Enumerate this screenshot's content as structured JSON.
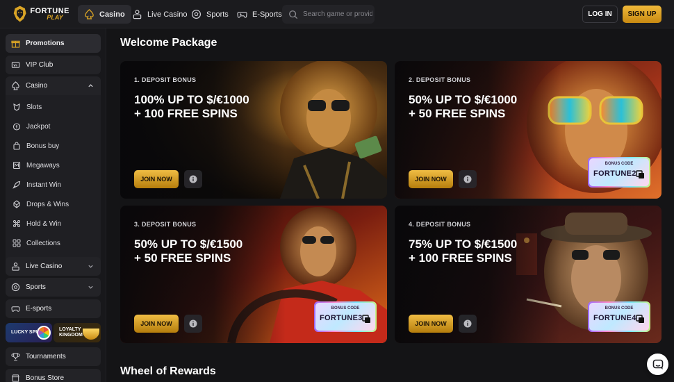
{
  "header": {
    "logo_line1": "FORTUNE",
    "logo_line2": "PLAY",
    "nav": [
      {
        "label": "Casino",
        "icon": "spade-icon",
        "active": true
      },
      {
        "label": "Live Casino",
        "icon": "dealer-icon",
        "active": false
      },
      {
        "label": "Sports",
        "icon": "soccer-ball-icon",
        "active": false
      },
      {
        "label": "E-Sports",
        "icon": "gamepad-icon",
        "active": false
      }
    ],
    "search_placeholder": "Search game or provider",
    "login_label": "LOG IN",
    "signup_label": "SIGN UP"
  },
  "sidebar": {
    "items": [
      {
        "label": "Promotions",
        "icon": "gift-icon"
      },
      {
        "label": "VIP Club",
        "icon": "vip-icon"
      },
      {
        "label": "Casino",
        "icon": "spade-icon",
        "expanded": true
      }
    ],
    "casino_sub": [
      {
        "label": "Slots",
        "icon": "slot-icon"
      },
      {
        "label": "Jackpot",
        "icon": "jackpot-icon"
      },
      {
        "label": "Bonus buy",
        "icon": "bag-icon"
      },
      {
        "label": "Megaways",
        "icon": "megaways-icon"
      },
      {
        "label": "Instant Win",
        "icon": "rocket-icon"
      },
      {
        "label": "Drops & Wins",
        "icon": "drops-icon"
      },
      {
        "label": "Hold & Win",
        "icon": "hold-icon"
      },
      {
        "label": "Collections",
        "icon": "collections-icon"
      }
    ],
    "items_after": [
      {
        "label": "Live Casino",
        "icon": "dealer-icon"
      },
      {
        "label": "Sports",
        "icon": "soccer-ball-icon"
      },
      {
        "label": "E-sports",
        "icon": "gamepad-icon"
      }
    ],
    "lucky_spin": "LUCKY SPIN",
    "loyalty_line1": "LOYALTY",
    "loyalty_line2": "KINGDOM",
    "tournaments": "Tournaments",
    "bonus_store": "Bonus Store"
  },
  "main": {
    "welcome_title": "Welcome Package",
    "wheel_title": "Wheel of Rewards",
    "cards": [
      {
        "label": "1. DEPOSIT BONUS",
        "line1": "100% UP TO $/€1000",
        "line2": "+ 100 FREE SPINS",
        "join": "JOIN NOW",
        "code_title": "",
        "code": ""
      },
      {
        "label": "2. DEPOSIT BONUS",
        "line1": "50% UP TO $/€1000",
        "line2": "+ 50 FREE SPINS",
        "join": "JOIN NOW",
        "code_title": "BONUS CODE",
        "code": "FORTUNE2"
      },
      {
        "label": "3. DEPOSIT BONUS",
        "line1": "50% UP TO $/€1500",
        "line2": "+ 50 FREE SPINS",
        "join": "JOIN NOW",
        "code_title": "BONUS CODE",
        "code": "FORTUNE3"
      },
      {
        "label": "4. DEPOSIT BONUS",
        "line1": "75% UP TO $/€1500",
        "line2": "+ 100 FREE SPINS",
        "join": "JOIN NOW",
        "code_title": "BONUS CODE",
        "code": "FORTUNE4"
      }
    ]
  },
  "colors": {
    "accent_gold": "#e0a62a",
    "bg": "#141416"
  }
}
